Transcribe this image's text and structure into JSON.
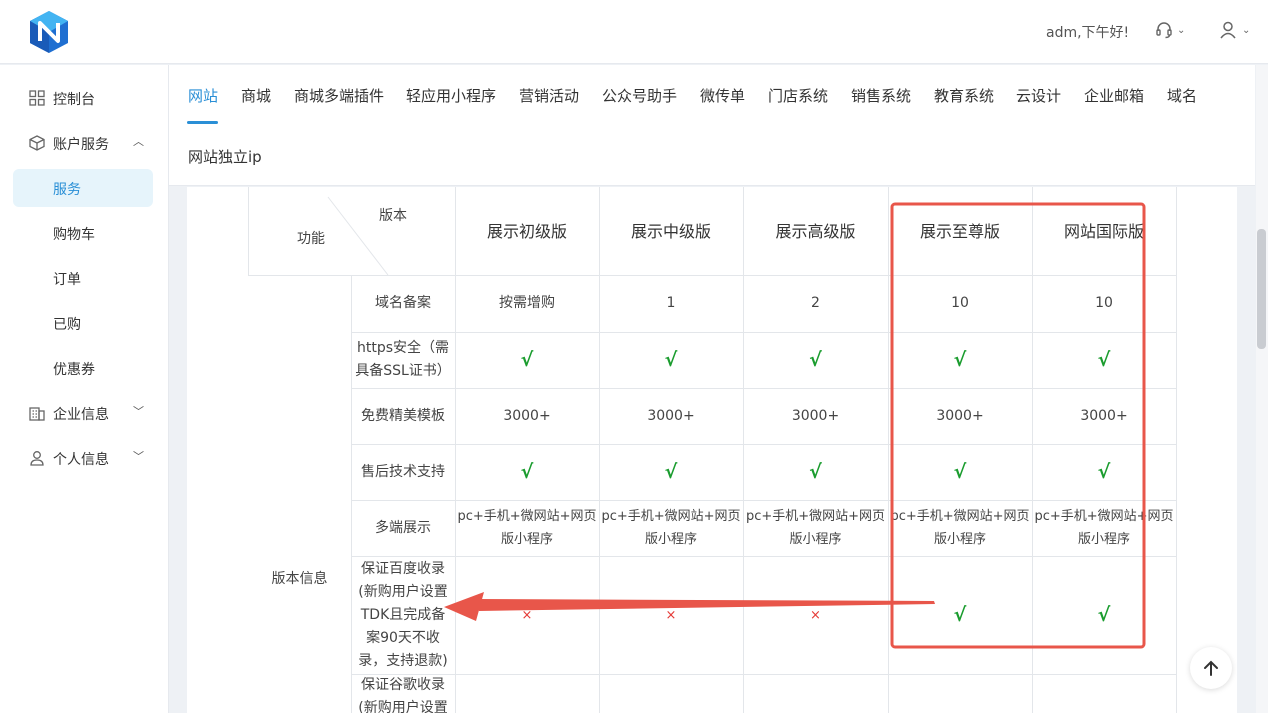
{
  "header": {
    "greeting": "adm,下午好!",
    "logo_icon": "brand-n-logo",
    "support_icon": "headset-icon",
    "user_icon": "user-icon"
  },
  "sidebar": {
    "items": [
      {
        "label": "控制台",
        "icon": "grid-icon"
      },
      {
        "label": "账户服务",
        "icon": "cube-icon",
        "expanded": true
      },
      {
        "label": "企业信息",
        "icon": "building-icon"
      },
      {
        "label": "个人信息",
        "icon": "person-icon"
      }
    ],
    "subitems": [
      "服务",
      "购物车",
      "订单",
      "已购",
      "优惠券"
    ],
    "active_sub": "服务"
  },
  "tabs": [
    "网站",
    "商城",
    "商城多端插件",
    "轻应用小程序",
    "营销活动",
    "公众号助手",
    "微传单",
    "门店系统",
    "销售系统",
    "教育系统",
    "云设计",
    "企业邮箱",
    "域名",
    "网站独立ip"
  ],
  "active_tab": "网站",
  "table": {
    "corner_version": "版本",
    "corner_function": "功能",
    "versions": [
      "展示初级版",
      "展示中级版",
      "展示高级版",
      "展示至尊版",
      "网站国际版"
    ],
    "group_label": "版本信息",
    "rows": [
      {
        "feature": "域名备案",
        "values": [
          "按需增购",
          "1",
          "2",
          "10",
          "10"
        ]
      },
      {
        "feature": "https安全（需具备SSL证书）",
        "values": [
          "√",
          "√",
          "√",
          "√",
          "√"
        ]
      },
      {
        "feature": "免费精美模板",
        "values": [
          "3000+",
          "3000+",
          "3000+",
          "3000+",
          "3000+"
        ]
      },
      {
        "feature": "售后技术支持",
        "values": [
          "√",
          "√",
          "√",
          "√",
          "√"
        ]
      },
      {
        "feature": "多端展示",
        "values": [
          "pc+手机+微网站+网页版小程序",
          "pc+手机+微网站+网页版小程序",
          "pc+手机+微网站+网页版小程序",
          "pc+手机+微网站+网页版小程序",
          "pc+手机+微网站+网页版小程序"
        ]
      },
      {
        "feature": "保证百度收录(新购用户设置TDK且完成备案90天不收录，支持退款)",
        "values": [
          "×",
          "×",
          "×",
          "√",
          "√"
        ]
      },
      {
        "feature": "保证谷歌收录(新购用户设置",
        "values": [
          "",
          "",
          "",
          "",
          ""
        ]
      }
    ]
  },
  "colors": {
    "accent": "#2a8fd6",
    "check": "#1a9c2e",
    "cross": "#e53935",
    "annotation": "#e8564a"
  }
}
